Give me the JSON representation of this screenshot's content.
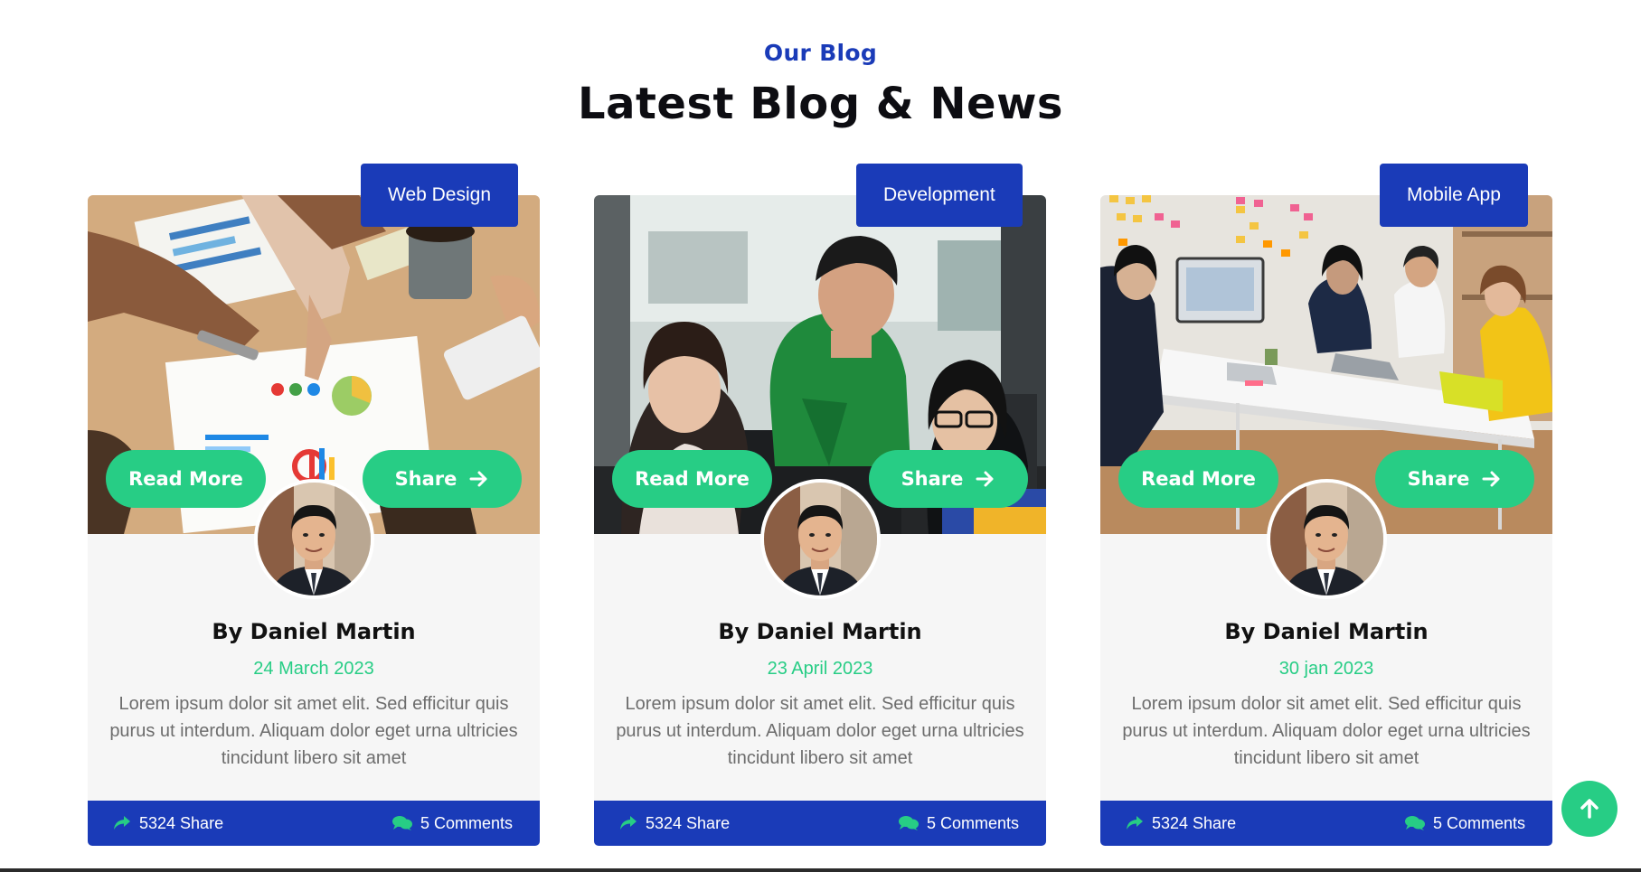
{
  "section": {
    "eyebrow": "Our Blog",
    "title": "Latest Blog & News"
  },
  "colors": {
    "brand_blue": "#1a3bb8",
    "accent_green": "#27cd85",
    "card_bg": "#f6f6f6"
  },
  "cards": [
    {
      "category": "Web Design",
      "read_more": "Read More",
      "share": "Share",
      "author": "By Daniel Martin",
      "date": "24 March 2023",
      "excerpt": "Lorem ipsum dolor sit amet elit. Sed efficitur quis purus ut interdum. Aliquam dolor eget urna ultricies tincidunt libero sit amet",
      "shares": "5324 Share",
      "comments": "5 Comments"
    },
    {
      "category": "Development",
      "read_more": "Read More",
      "share": "Share",
      "author": "By Daniel Martin",
      "date": "23 April 2023",
      "excerpt": "Lorem ipsum dolor sit amet elit. Sed efficitur quis purus ut interdum. Aliquam dolor eget urna ultricies tincidunt libero sit amet",
      "shares": "5324 Share",
      "comments": "5 Comments"
    },
    {
      "category": "Mobile App",
      "read_more": "Read More",
      "share": "Share",
      "author": "By Daniel Martin",
      "date": "30 jan 2023",
      "excerpt": "Lorem ipsum dolor sit amet elit. Sed efficitur quis purus ut interdum. Aliquam dolor eget urna ultricies tincidunt libero sit amet",
      "shares": "5324 Share",
      "comments": "5 Comments"
    }
  ],
  "icons": {
    "share_arrow": "arrow-right-icon",
    "share_count": "share-forward-icon",
    "comments": "comments-icon",
    "scroll_top": "arrow-up-icon"
  }
}
